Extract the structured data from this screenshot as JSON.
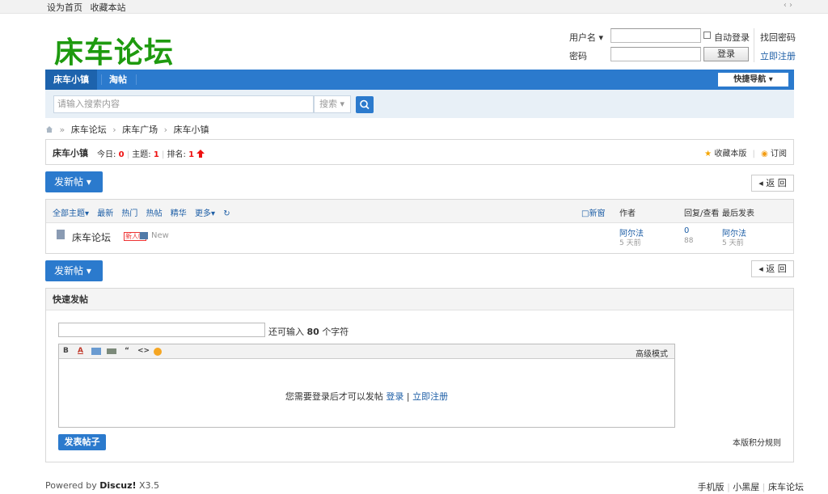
{
  "topbar": {
    "set_home": "设为首页",
    "bookmark": "收藏本站",
    "arrows": "‹ ›"
  },
  "header": {
    "logo_text": "床车论坛",
    "login": {
      "username_label": "用户名 ▾",
      "password_label": "密码",
      "auto_login": "自动登录",
      "login_button": "登录",
      "find_password": "找回密码",
      "register": "立即注册"
    }
  },
  "nav": {
    "tabs": [
      {
        "label": "床车小镇"
      },
      {
        "label": "淘帖"
      }
    ],
    "quick_nav": "快捷导航 ▾"
  },
  "search": {
    "placeholder": "请输入搜索内容",
    "type_select": "搜索 ▾"
  },
  "breadcrumb": {
    "items": [
      "床车论坛",
      "床车广场",
      "床车小镇"
    ]
  },
  "forum": {
    "name": "床车小镇",
    "today_label": "今日:",
    "today_value": "0",
    "topics_label": "主题:",
    "topics_value": "1",
    "rank_label": "排名:",
    "rank_value": "1",
    "favorite": "收藏本版",
    "subscribe": "订阅"
  },
  "actions": {
    "new_post": "发新帖 ▾",
    "back": "◂ 返 回"
  },
  "thread_list": {
    "filters": [
      "全部主题▾",
      "最新",
      "热门",
      "热帖",
      "精华",
      "更多▾",
      "↻"
    ],
    "new_window": "□新窗",
    "col_author": "作者",
    "col_replies": "回复/查看",
    "col_last": "最后发表",
    "rows": [
      {
        "title": "床车论坛",
        "badge": "新人帖",
        "new_label": "New",
        "author": "阿尔法",
        "author_time": "5 天前",
        "replies": "0",
        "views": "88",
        "last_user": "阿尔法",
        "last_time": "5 天前"
      }
    ]
  },
  "quick_post": {
    "title": "快速发帖",
    "remain_prefix": "还可输入",
    "remain_count": "80",
    "remain_suffix": "个字符",
    "advanced": "高级模式",
    "login_msg": "您需要登录后才可以发帖",
    "login_link": "登录",
    "register_link": "立即注册",
    "post_button": "发表帖子",
    "rules": "本版积分规则"
  },
  "footer": {
    "powered": "Powered by",
    "product": "Discuz!",
    "version": "X3.5",
    "mobile": "手机版",
    "blackroom": "小黑屋",
    "site": "床车论坛"
  },
  "colors": {
    "nav_blue": "#2b7acd",
    "logo_green": "#1e9a0f",
    "accent_red": "#e11111"
  }
}
